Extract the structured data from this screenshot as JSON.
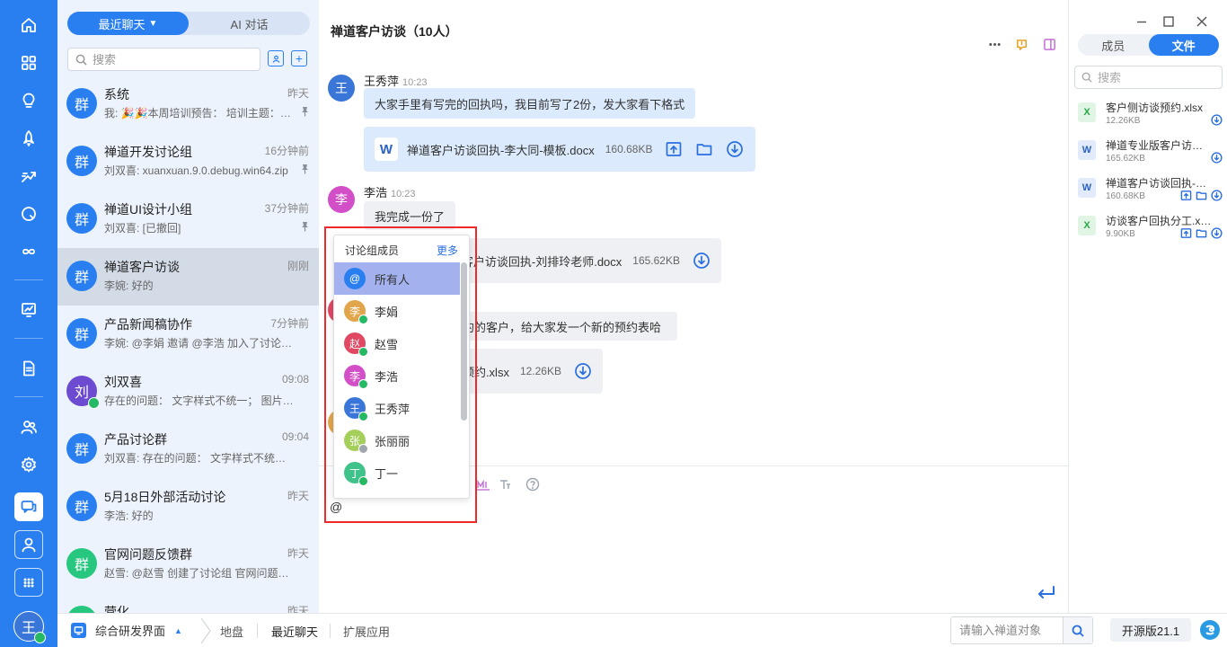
{
  "colors": {
    "brand": "#2a7ff0",
    "selected_row": "#a3b2ee",
    "highlight_box": "#ee2a2a",
    "online": "#25b964"
  },
  "rail": {
    "icons": [
      "home-icon",
      "apps-grid-icon",
      "lightbulb-icon",
      "rocket-icon",
      "sprint-icon",
      "search-circle-icon",
      "infinity-icon",
      "presentation-icon",
      "document-icon",
      "team-icon",
      "settings-icon",
      "chat-icon",
      "user-icon",
      "more-apps-icon"
    ],
    "user_avatar": "王"
  },
  "chat_list": {
    "tabs": [
      {
        "label": "最近聊天",
        "active": true
      },
      {
        "label": "AI 对话",
        "active": false
      }
    ],
    "search_placeholder": "搜索",
    "items": [
      {
        "avatar": "群",
        "color": "#2a7ff0",
        "name": "系统",
        "time": "昨天",
        "last": "我: 🎉🎉本周培训预告： 培训主题：…",
        "pinned": true
      },
      {
        "avatar": "群",
        "color": "#2a7ff0",
        "name": "禅道开发讨论组",
        "time": "16分钟前",
        "last": "刘双喜: xuanxuan.9.0.debug.win64.zip",
        "pinned": true
      },
      {
        "avatar": "群",
        "color": "#2a7ff0",
        "name": "禅道UI设计小组",
        "time": "37分钟前",
        "last": "刘双喜: [已撤回]",
        "pinned": true
      },
      {
        "avatar": "群",
        "color": "#2a7ff0",
        "name": "禅道客户访谈",
        "time": "刚刚",
        "last": "李婉: 好的",
        "pinned": false,
        "active": true
      },
      {
        "avatar": "群",
        "color": "#2a7ff0",
        "name": "产品新闻稿协作",
        "time": "7分钟前",
        "last": "李婉: @李娟 邀请 @李浩 加入了讨论组。",
        "pinned": false
      },
      {
        "avatar": "刘",
        "color": "#6d4bd1",
        "name": "刘双喜",
        "time": "09:08",
        "last": "存在的问题： 文字样式不统一； 图片大…",
        "pinned": false,
        "online": true
      },
      {
        "avatar": "群",
        "color": "#2a7ff0",
        "name": "产品讨论群",
        "time": "09:04",
        "last": "刘双喜: 存在的问题： 文字样式不统一；…",
        "pinned": false
      },
      {
        "avatar": "群",
        "color": "#2a7ff0",
        "name": "5月18日外部活动讨论",
        "time": "昨天",
        "last": "李浩: 好的",
        "pinned": false
      },
      {
        "avatar": "群",
        "color": "#28c77f",
        "name": "官网问题反馈群",
        "time": "昨天",
        "last": "赵雪: @赵雪 创建了讨论组 官网问题反…",
        "pinned": false
      },
      {
        "avatar": "群",
        "color": "#28c77f",
        "name": "营化",
        "time": "昨天",
        "last": "",
        "pinned": false
      }
    ]
  },
  "chat": {
    "title": "禅道客户访谈（10人）",
    "header_icons": [
      "more-icon",
      "notice-icon",
      "sidebar-toggle-icon"
    ],
    "messages": [
      {
        "avatar": "王",
        "color": "#3a76d8",
        "sender": "王秀萍",
        "time": "10:23",
        "text": "大家手里有写完的回执吗，我目前写了2份，发大家看下格式",
        "file": {
          "type": "W",
          "name": "禅道客户访谈回执-李大同-模板.docx",
          "size": "160.68KB"
        }
      },
      {
        "avatar": "李",
        "color": "#d24fc7",
        "sender": "李浩",
        "time": "10:23",
        "text": "我完成一份了",
        "file": {
          "type": "W",
          "name": "禅道客户访谈回执-刘排玲老师.docx",
          "size": "165.62KB"
        }
      },
      {
        "text": "有新约的客户，给大家发一个新的预约表哈",
        "file": {
          "type": "X",
          "name": "客户侧访谈预约.xlsx",
          "size": "12.26KB"
        }
      }
    ],
    "visible_fragments": {
      "file2": "客户访谈回执-刘排玲老师.docx",
      "text3": "约的客户，给大家发一个新的预约表哈",
      "file3": "预约.xlsx"
    },
    "input_value": "@",
    "toolbar_icons": [
      "emoji-icon",
      "font-size-icon",
      "help-icon"
    ]
  },
  "mention_popup": {
    "title": "讨论组成员",
    "more": "更多",
    "members": [
      {
        "name": "所有人",
        "avatar": "@",
        "color": "#2a7ff0",
        "selected": true,
        "status": "none"
      },
      {
        "name": "李娟",
        "avatar": "李",
        "color": "#e1a64b",
        "status": "online"
      },
      {
        "name": "赵雪",
        "avatar": "赵",
        "color": "#e04863",
        "status": "online"
      },
      {
        "name": "李浩",
        "avatar": "李",
        "color": "#d24fc7",
        "status": "online"
      },
      {
        "name": "王秀萍",
        "avatar": "王",
        "color": "#3a76d8",
        "status": "online"
      },
      {
        "name": "张丽丽",
        "avatar": "张",
        "color": "#a4cf5a",
        "status": "away"
      },
      {
        "name": "丁一",
        "avatar": "丁",
        "color": "#3fc38a",
        "status": "online"
      }
    ]
  },
  "right_panel": {
    "tabs": [
      {
        "label": "成员",
        "active": false
      },
      {
        "label": "文件",
        "active": true
      }
    ],
    "search_placeholder": "搜索",
    "files": [
      {
        "type": "X",
        "name": "客户侧访谈预约.xlsx",
        "size": "12.26KB",
        "actions": [
          "download"
        ]
      },
      {
        "type": "W",
        "name": "禅道专业版客户访谈回执.docx",
        "size": "165.62KB",
        "actions": [
          "download"
        ]
      },
      {
        "type": "W",
        "name": "禅道客户访谈回执-李大同.docx",
        "size": "160.68KB",
        "actions": [
          "open",
          "folder",
          "download"
        ]
      },
      {
        "type": "X",
        "name": "访谈客户回执分工.xlsx",
        "size": "9.90KB",
        "actions": [
          "open",
          "folder",
          "download"
        ]
      }
    ]
  },
  "bottom_bar": {
    "app_name": "综合研发界面",
    "tabs": [
      {
        "label": "地盘",
        "active": false
      },
      {
        "label": "最近聊天",
        "active": true
      },
      {
        "label": "扩展应用",
        "active": false
      }
    ],
    "search_placeholder": "请输入禅道对象",
    "version": "开源版21.1"
  }
}
